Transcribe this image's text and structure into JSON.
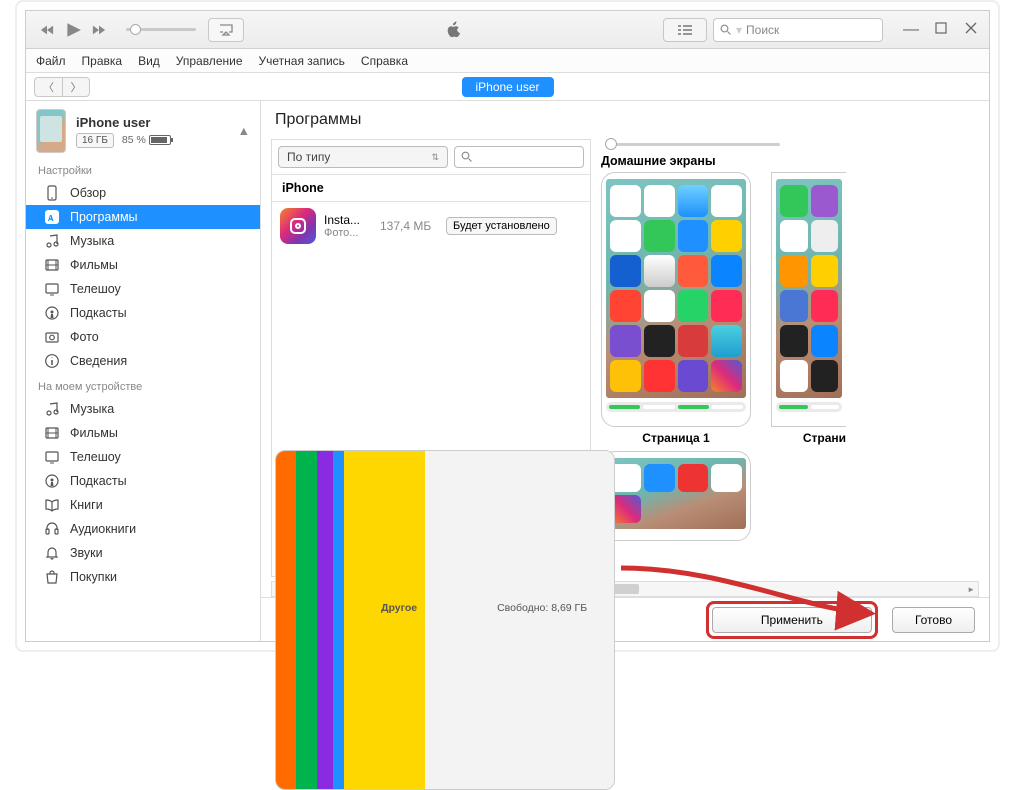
{
  "toolbar": {
    "search_placeholder": "Поиск"
  },
  "menu": {
    "file": "Файл",
    "edit": "Правка",
    "view": "Вид",
    "controls": "Управление",
    "account": "Учетная запись",
    "help": "Справка"
  },
  "nav": {
    "pill": "iPhone user"
  },
  "device": {
    "name": "iPhone user",
    "storage": "16 ГБ",
    "battery": "85 %"
  },
  "sidebar": {
    "settings_label": "Настройки",
    "settings": [
      {
        "label": "Обзор"
      },
      {
        "label": "Программы"
      },
      {
        "label": "Музыка"
      },
      {
        "label": "Фильмы"
      },
      {
        "label": "Телешоу"
      },
      {
        "label": "Подкасты"
      },
      {
        "label": "Фото"
      },
      {
        "label": "Сведения"
      }
    ],
    "ondevice_label": "На моем устройстве",
    "ondevice": [
      {
        "label": "Музыка"
      },
      {
        "label": "Фильмы"
      },
      {
        "label": "Телешоу"
      },
      {
        "label": "Подкасты"
      },
      {
        "label": "Книги"
      },
      {
        "label": "Аудиокниги"
      },
      {
        "label": "Звуки"
      },
      {
        "label": "Покупки"
      }
    ]
  },
  "main": {
    "title": "Программы",
    "sort": "По типу",
    "group": "iPhone",
    "app": {
      "name": "Insta...",
      "sub": "Фото...",
      "size": "137,4 МБ",
      "action": "Будет установлено"
    },
    "home_title": "Домашние экраны",
    "page1": "Страница 1",
    "page2": "Страни"
  },
  "footer": {
    "other": "Другое",
    "free": "Свободно: 8,69 ГБ",
    "apply": "Применить",
    "done": "Готово"
  }
}
